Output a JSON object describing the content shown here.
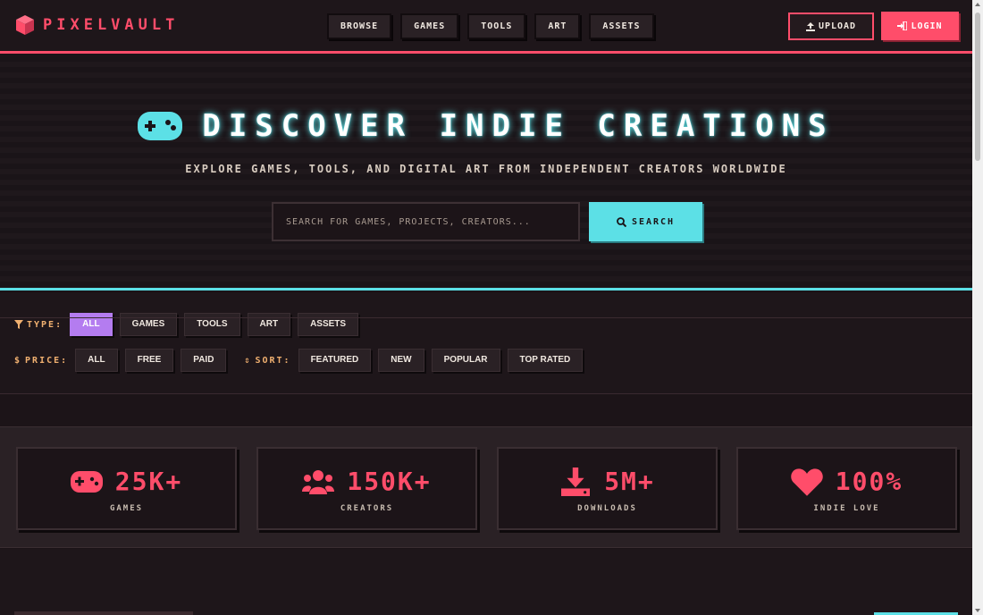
{
  "header": {
    "logo_text": "PIXELVAULT",
    "nav": [
      "BROWSE",
      "GAMES",
      "TOOLS",
      "ART",
      "ASSETS"
    ],
    "upload_label": "UPLOAD",
    "login_label": "LOGIN"
  },
  "hero": {
    "title": "DISCOVER INDIE CREATIONS",
    "subtitle": "EXPLORE GAMES, TOOLS, AND DIGITAL ART FROM INDEPENDENT CREATORS WORLDWIDE",
    "search_placeholder": "SEARCH FOR GAMES, PROJECTS, CREATORS...",
    "search_button": "SEARCH"
  },
  "filters": {
    "type_label": "TYPE:",
    "type_options": [
      "ALL",
      "GAMES",
      "TOOLS",
      "ART",
      "ASSETS"
    ],
    "type_selected": "ALL",
    "price_label": "PRICE:",
    "price_options": [
      "ALL",
      "FREE",
      "PAID"
    ],
    "sort_label": "SORT:",
    "sort_options": [
      "FEATURED",
      "NEW",
      "POPULAR",
      "TOP RATED"
    ]
  },
  "stats": [
    {
      "icon": "gamepad-icon",
      "value": "25K+",
      "label": "GAMES"
    },
    {
      "icon": "users-icon",
      "value": "150K+",
      "label": "CREATORS"
    },
    {
      "icon": "download-icon",
      "value": "5M+",
      "label": "DOWNLOADS"
    },
    {
      "icon": "heart-icon",
      "value": "100%",
      "label": "INDIE LOVE"
    }
  ],
  "colors": {
    "accent": "#ff4d6a",
    "cyan": "#5ce0e6",
    "purple": "#b47cf0",
    "label_orange": "#f0b070",
    "background": "#1c1418"
  }
}
